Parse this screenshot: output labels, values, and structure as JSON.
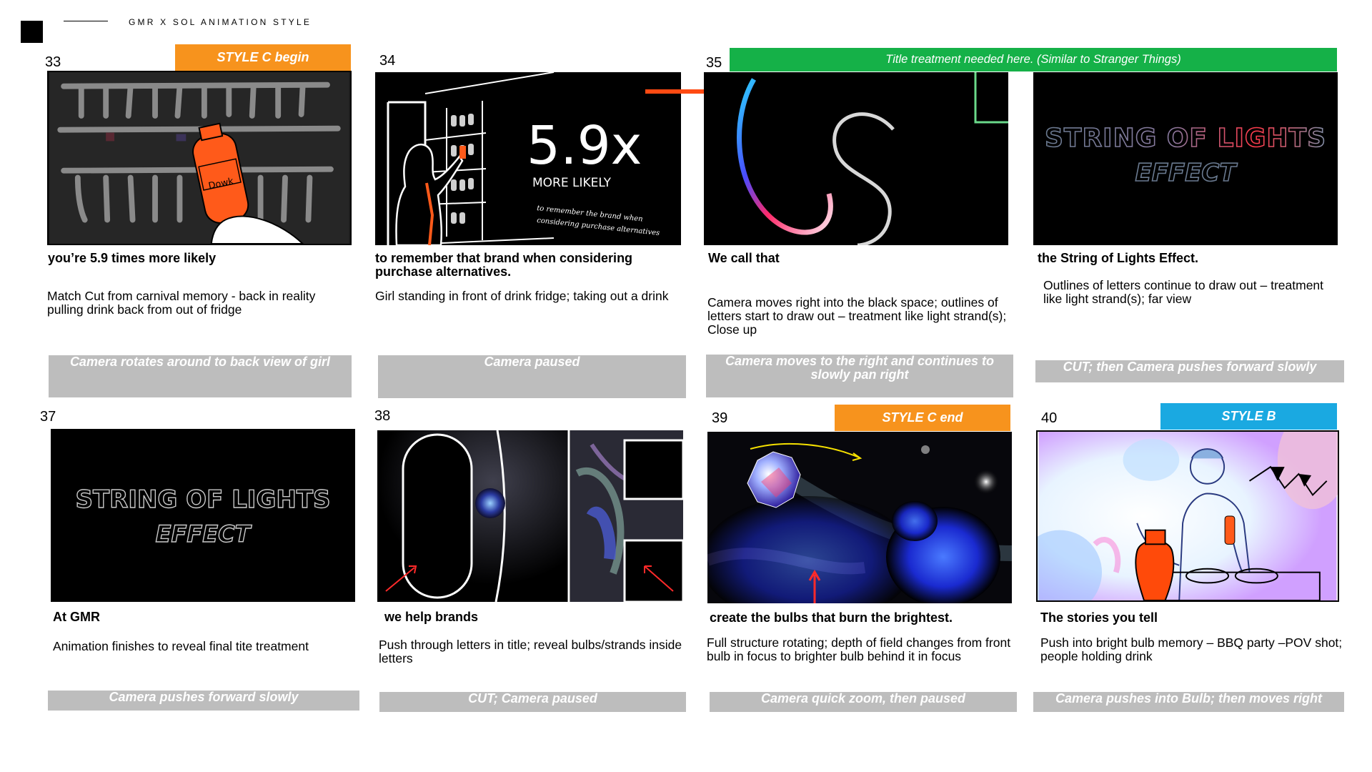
{
  "header": {
    "title": "GMR X SOL ANIMATION STYLE"
  },
  "colors": {
    "orange": "#f7931d",
    "green": "#15b148",
    "blue": "#1aa9e1",
    "grey": "#bdbdbd",
    "arrow": "#ff4a12"
  },
  "panels": [
    {
      "number": "33",
      "tag": "STYLE C  begin",
      "vo": "you’re 5.9 times more likely",
      "desc": "Match Cut from carnival memory - back in reality pulling drink back from out of fridge",
      "camera": "Camera rotates around to back view of girl",
      "frame_text": "Dowk"
    },
    {
      "number": "34",
      "vo": "to remember that brand when considering purchase alternatives.",
      "desc": "Girl standing in front of drink fridge; taking out a drink",
      "camera": "Camera  paused",
      "frame_big": "5.9x",
      "frame_likely": "MORE LIKELY",
      "frame_small1": "to remember the brand when",
      "frame_small2": "considering purchase alternatives"
    },
    {
      "number": "35",
      "banner": "Title treatment needed here. (Similar to Stranger Things)",
      "vo": "We call that",
      "desc": "Camera moves right into the black space; outlines of letters start to draw out – treatment like light strand(s); Close up",
      "camera": "Camera moves to the right and continues to slowly pan right"
    },
    {
      "vo": "the String of Lights Effect.",
      "desc": "Outlines of letters continue to draw out – treatment like light strand(s); far view",
      "camera": "CUT; then Camera  pushes forward slowly",
      "frame_line1": "STRING OF LIGHTS",
      "frame_line2": "EFFECT"
    },
    {
      "number": "37",
      "vo": "At GMR",
      "desc": "Animation finishes to reveal final tite treatment",
      "camera": "Camera pushes forward slowly",
      "frame_line1": "STRING OF LIGHTS",
      "frame_line2": "EFFECT"
    },
    {
      "number": "38",
      "vo": "we help brands",
      "desc": "Push through letters in title; reveal bulbs/strands inside letters",
      "camera": "CUT; Camera paused"
    },
    {
      "number": "39",
      "tag": "STYLE C  end",
      "vo": "create the bulbs that burn the brightest.",
      "desc": "Full structure rotating; depth of field changes from front bulb in focus to brighter bulb behind it in focus",
      "camera": "Camera quick zoom, then paused"
    },
    {
      "number": "40",
      "tag": "STYLE B",
      "vo": "The stories you tell",
      "desc": "Push into bright bulb memory – BBQ party –POV shot; people holding drink",
      "camera": "Camera pushes into Bulb; then moves right"
    }
  ]
}
